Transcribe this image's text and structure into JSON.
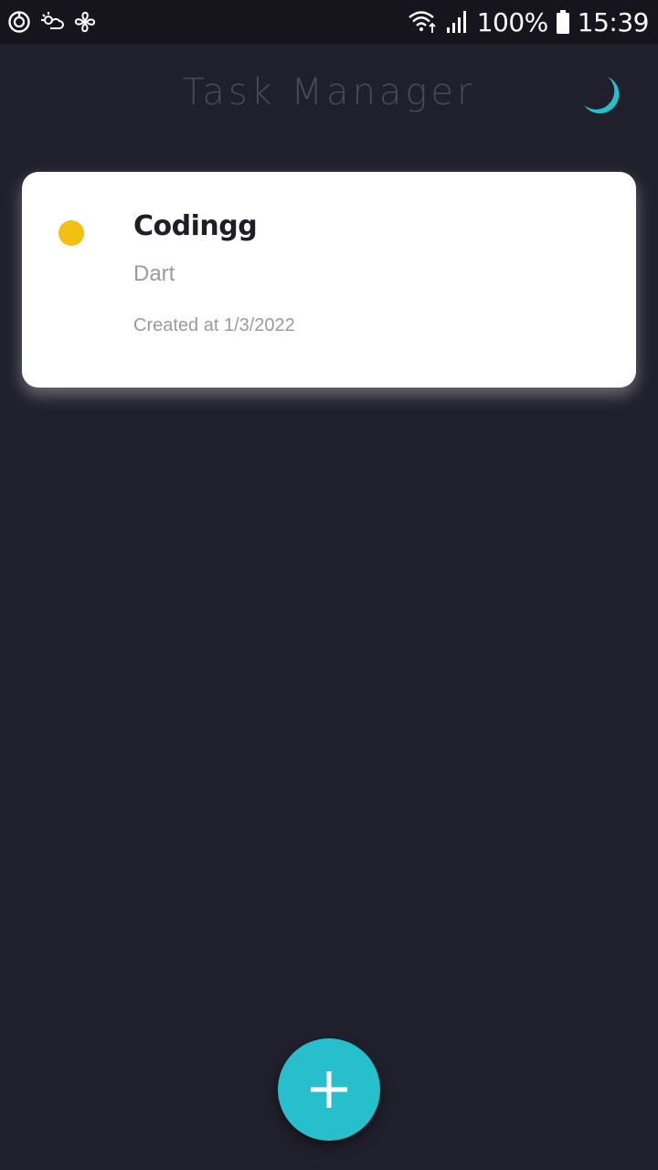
{
  "status_bar": {
    "left_icons": [
      "data-saver-icon",
      "weather-icon",
      "fan-icon"
    ],
    "right_icons": [
      "wifi-icon",
      "signal-icon",
      "battery-icon"
    ],
    "battery": "100%",
    "time": "15:39"
  },
  "header": {
    "title": "Task Manager",
    "theme_toggle_icon": "moon-icon"
  },
  "tasks": [
    {
      "title": "Codingg",
      "subtitle": "Dart",
      "created": "Created at 1/3/2022",
      "dot_color": "#f2c010"
    }
  ],
  "fab": {
    "icon": "plus-icon"
  },
  "colors": {
    "background": "#201f2c",
    "status_bar": "#16151e",
    "accent": "#26bfcb",
    "card": "#ffffff",
    "title_muted": "#4a4955"
  }
}
